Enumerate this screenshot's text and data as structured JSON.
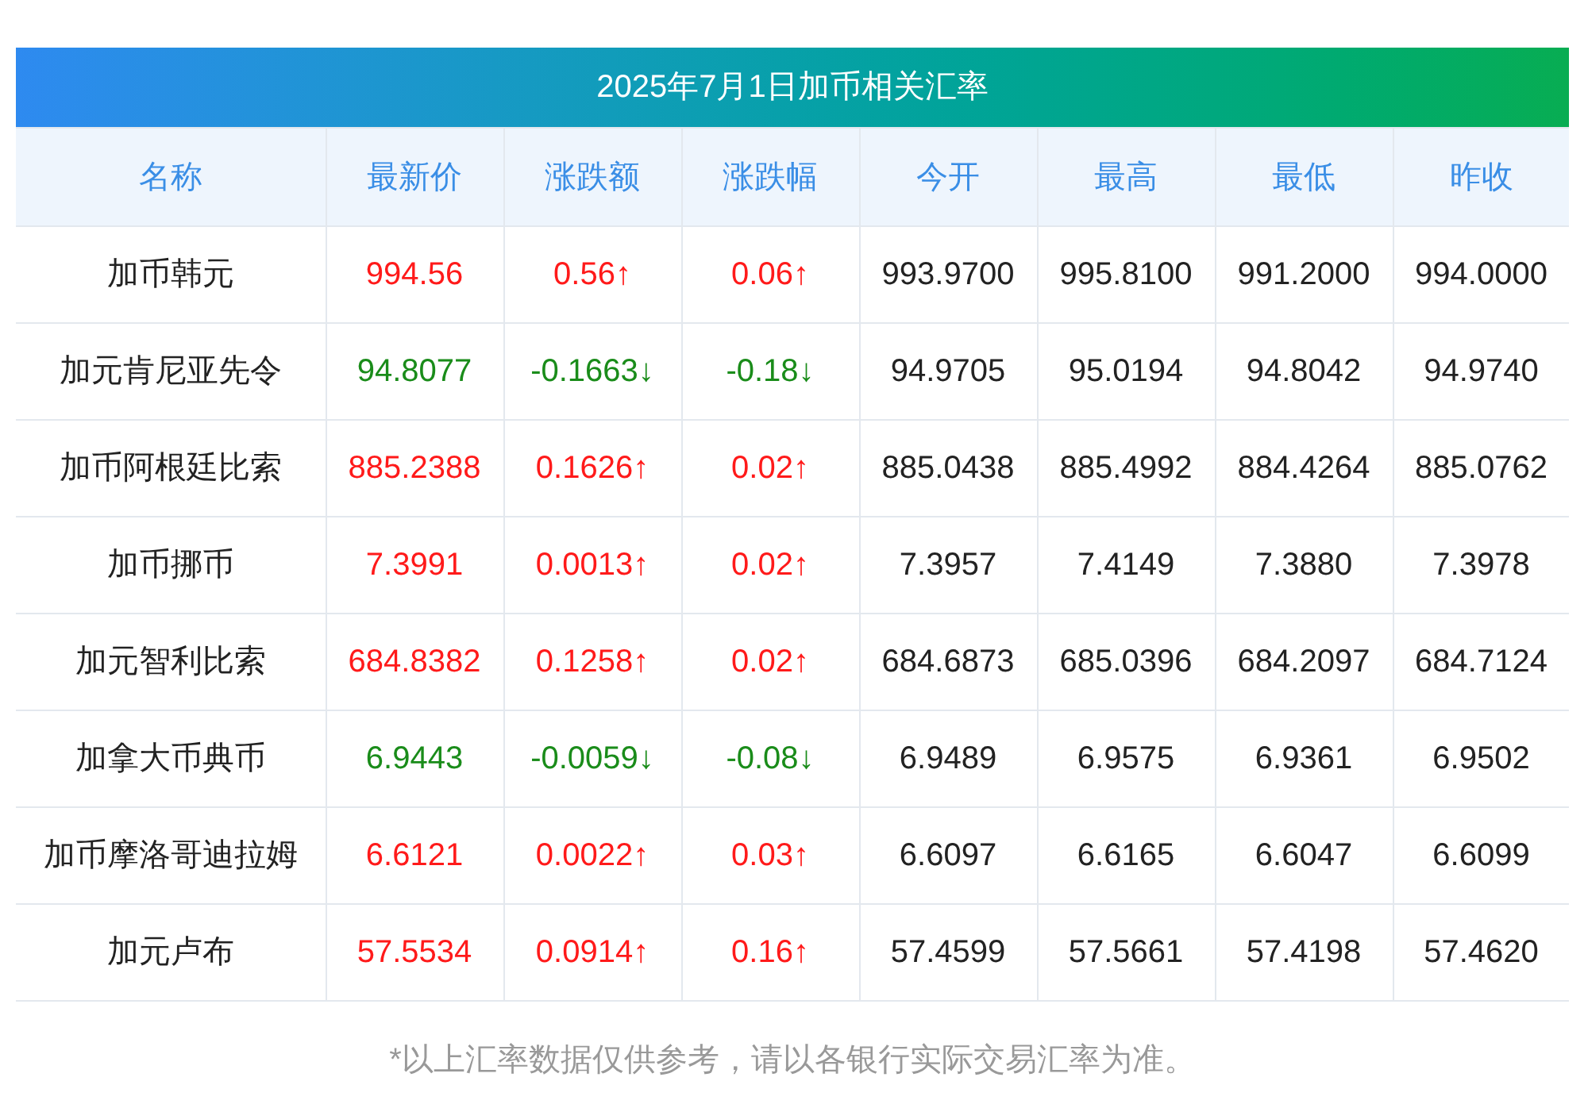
{
  "title": "2025年7月1日加币相关汇率",
  "columns": [
    "名称",
    "最新价",
    "涨跌额",
    "涨跌幅",
    "今开",
    "最高",
    "最低",
    "昨收"
  ],
  "rows": [
    {
      "color": "#ff1a1a",
      "cells": [
        "加币韩元",
        "994.56",
        "0.56↑",
        "0.06↑",
        "993.9700",
        "995.8100",
        "991.2000",
        "994.0000"
      ]
    },
    {
      "color": "#1a8c1a",
      "cells": [
        "加元肯尼亚先令",
        "94.8077",
        "-0.1663↓",
        "-0.18↓",
        "94.9705",
        "95.0194",
        "94.8042",
        "94.9740"
      ]
    },
    {
      "color": "#ff1a1a",
      "cells": [
        "加币阿根廷比索",
        "885.2388",
        "0.1626↑",
        "0.02↑",
        "885.0438",
        "885.4992",
        "884.4264",
        "885.0762"
      ]
    },
    {
      "color": "#ff1a1a",
      "cells": [
        "加币挪币",
        "7.3991",
        "0.0013↑",
        "0.02↑",
        "7.3957",
        "7.4149",
        "7.3880",
        "7.3978"
      ]
    },
    {
      "color": "#ff1a1a",
      "cells": [
        "加元智利比索",
        "684.8382",
        "0.1258↑",
        "0.02↑",
        "684.6873",
        "685.0396",
        "684.2097",
        "684.7124"
      ]
    },
    {
      "color": "#1a8c1a",
      "cells": [
        "加拿大币典币",
        "6.9443",
        "-0.0059↓",
        "-0.08↓",
        "6.9489",
        "6.9575",
        "6.9361",
        "6.9502"
      ]
    },
    {
      "color": "#ff1a1a",
      "cells": [
        "加币摩洛哥迪拉姆",
        "6.6121",
        "0.0022↑",
        "0.03↑",
        "6.6097",
        "6.6165",
        "6.6047",
        "6.6099"
      ]
    },
    {
      "color": "#ff1a1a",
      "cells": [
        "加元卢布",
        "57.5534",
        "0.0914↑",
        "0.16↑",
        "57.4599",
        "57.5661",
        "57.4198",
        "57.4620"
      ]
    }
  ],
  "footnote": "*以上汇率数据仅供参考，请以各银行实际交易汇率为准。"
}
